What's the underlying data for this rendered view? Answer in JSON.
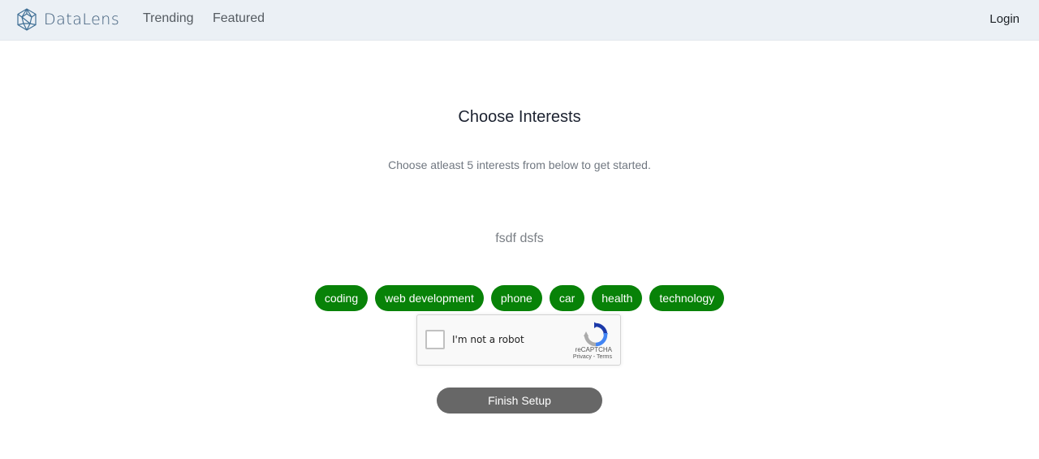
{
  "navbar": {
    "brand": "DataLens",
    "links": [
      {
        "label": "Trending"
      },
      {
        "label": "Featured"
      }
    ],
    "login_label": "Login"
  },
  "main": {
    "title": "Choose Interests",
    "subtitle": "Choose atleast 5 interests from below to get started.",
    "username": "fsdf dsfs",
    "interests": [
      "coding",
      "web development",
      "phone",
      "car",
      "health",
      "technology"
    ],
    "finish_label": "Finish Setup"
  },
  "captcha": {
    "label": "I'm not a robot",
    "brand": "reCAPTCHA",
    "privacy": "Privacy",
    "separator": " - ",
    "terms": "Terms",
    "checked": false
  },
  "colors": {
    "navbar_bg": "#ebf0f5",
    "chip_bg": "#088208",
    "finish_bg": "#676767",
    "brand_text": "#3b5a78"
  },
  "icons": {
    "brand_logo": "geodesic-sphere-icon",
    "captcha_logo": "recaptcha-icon"
  }
}
